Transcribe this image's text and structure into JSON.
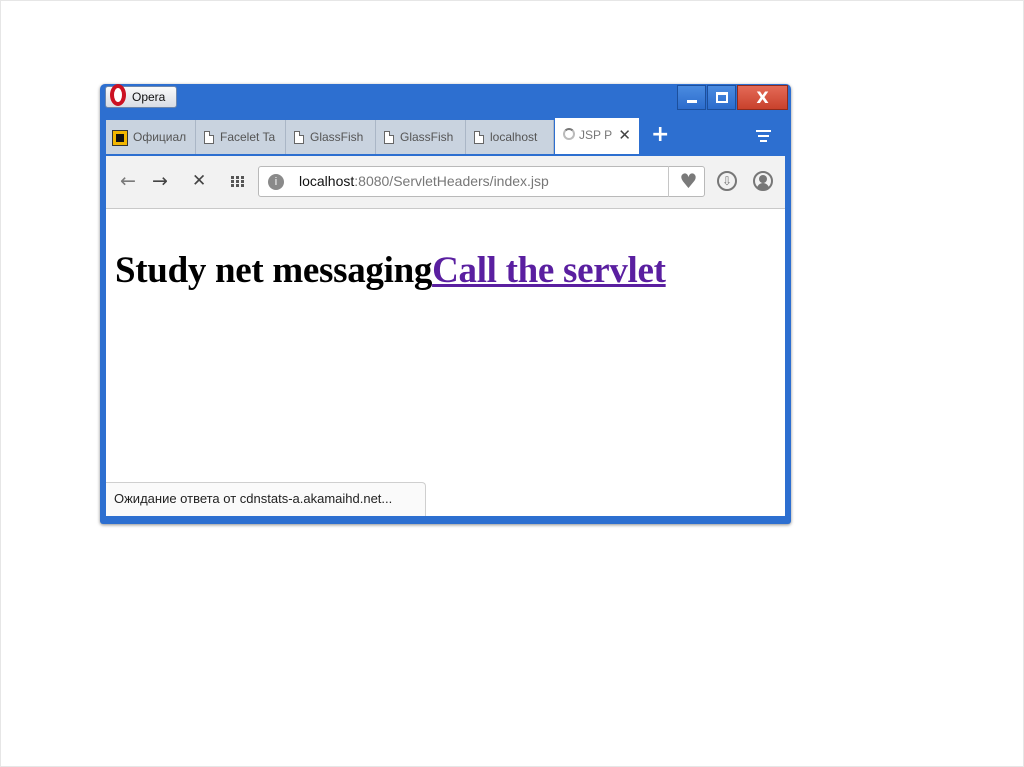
{
  "window": {
    "opera_label": "Opera",
    "controls": {
      "minimize": "minimize",
      "maximize": "maximize",
      "close": "X"
    }
  },
  "tabs": [
    {
      "title": "Официал",
      "icon": "favicon-brand-icon"
    },
    {
      "title": "Facelet Ta",
      "icon": "page-icon"
    },
    {
      "title": "GlassFish",
      "icon": "page-icon"
    },
    {
      "title": "GlassFish",
      "icon": "page-icon"
    },
    {
      "title": "localhost",
      "icon": "page-icon"
    },
    {
      "title": "JSP P",
      "icon": "loading-spinner-icon",
      "active": true
    }
  ],
  "new_tab_label": "+",
  "toolbar": {
    "back": "←",
    "forward": "→",
    "stop": "✕",
    "url_host": "localhost",
    "url_rest": ":8080/ServletHeaders/index.jsp",
    "bookmark_glyph": "♥",
    "download_glyph": "⇩"
  },
  "page": {
    "heading_text": "Study net messaging",
    "link_text": "Call the servlet"
  },
  "status_bar": "Ожидание ответа от cdnstats-a.akamaihd.net...",
  "colors": {
    "frame": "#2d6fd0",
    "close_button": "#c8412c",
    "link": "#5a1fa0"
  }
}
